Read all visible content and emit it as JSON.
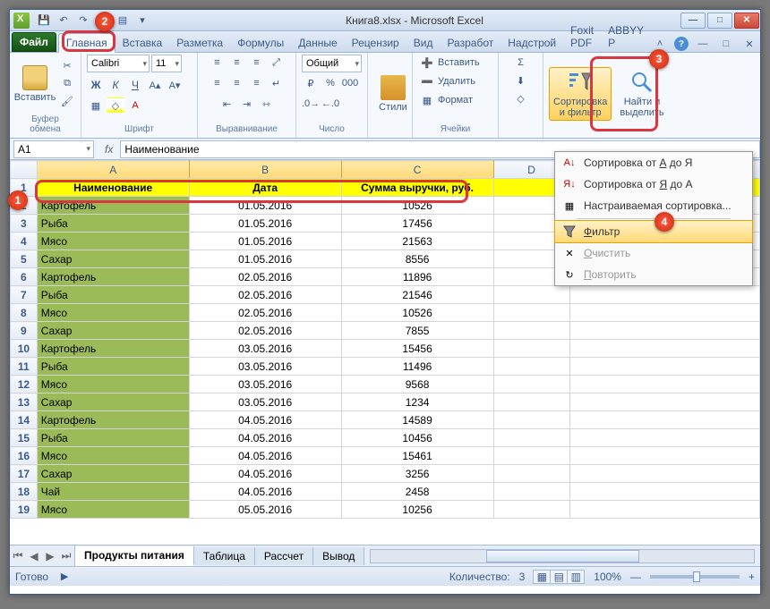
{
  "title": "Книга8.xlsx - Microsoft Excel",
  "qat": [
    "save",
    "undo",
    "redo",
    "print",
    "new"
  ],
  "tabs": {
    "file": "Файл",
    "items": [
      "Главная",
      "Вставка",
      "Разметка",
      "Формулы",
      "Данные",
      "Рецензир",
      "Вид",
      "Разработ",
      "Надстрой",
      "Foxit PDF",
      "ABBYY P"
    ],
    "active": 0
  },
  "ribbon": {
    "clipboard": {
      "label": "Буфер обмена",
      "paste": "Вставить"
    },
    "font": {
      "label": "Шрифт",
      "name": "Calibri",
      "size": "11"
    },
    "align": {
      "label": "Выравнивание"
    },
    "number": {
      "label": "Число",
      "format": "Общий"
    },
    "styles": {
      "label": "Стили"
    },
    "cells": {
      "label": "Ячейки",
      "insert": "Вставить",
      "delete": "Удалить",
      "format": "Формат"
    },
    "editing": {
      "sort": "Сортировка\nи фильтр",
      "find": "Найти и\nвыделить"
    }
  },
  "dropdown": {
    "sort_az": "Сортировка от А до Я",
    "sort_za": "Сортировка от Я до А",
    "custom": "Настраиваемая сортировка...",
    "filter": "Фильтр",
    "clear": "Очистить",
    "reapply": "Повторить",
    "az_u": "А",
    "za_u": "Я",
    "f_u": "Ф",
    "c_u": "О",
    "r_u": "П"
  },
  "namebox": "A1",
  "formula": "Наименование",
  "columns": [
    "A",
    "B",
    "C",
    "D"
  ],
  "header_row": [
    "Наименование",
    "Дата",
    "Сумма выручки, руб."
  ],
  "rows": [
    {
      "n": 2,
      "a": "Картофель",
      "b": "01.05.2016",
      "c": "10526"
    },
    {
      "n": 3,
      "a": "Рыба",
      "b": "01.05.2016",
      "c": "17456"
    },
    {
      "n": 4,
      "a": "Мясо",
      "b": "01.05.2016",
      "c": "21563"
    },
    {
      "n": 5,
      "a": "Сахар",
      "b": "01.05.2016",
      "c": "8556"
    },
    {
      "n": 6,
      "a": "Картофель",
      "b": "02.05.2016",
      "c": "11896"
    },
    {
      "n": 7,
      "a": "Рыба",
      "b": "02.05.2016",
      "c": "21546"
    },
    {
      "n": 8,
      "a": "Мясо",
      "b": "02.05.2016",
      "c": "10526"
    },
    {
      "n": 9,
      "a": "Сахар",
      "b": "02.05.2016",
      "c": "7855"
    },
    {
      "n": 10,
      "a": "Картофель",
      "b": "03.05.2016",
      "c": "15456"
    },
    {
      "n": 11,
      "a": "Рыба",
      "b": "03.05.2016",
      "c": "11496"
    },
    {
      "n": 12,
      "a": "Мясо",
      "b": "03.05.2016",
      "c": "9568"
    },
    {
      "n": 13,
      "a": "Сахар",
      "b": "03.05.2016",
      "c": "1234"
    },
    {
      "n": 14,
      "a": "Картофель",
      "b": "04.05.2016",
      "c": "14589"
    },
    {
      "n": 15,
      "a": "Рыба",
      "b": "04.05.2016",
      "c": "10456"
    },
    {
      "n": 16,
      "a": "Мясо",
      "b": "04.05.2016",
      "c": "15461"
    },
    {
      "n": 17,
      "a": "Сахар",
      "b": "04.05.2016",
      "c": "3256"
    },
    {
      "n": 18,
      "a": "Чай",
      "b": "04.05.2016",
      "c": "2458"
    },
    {
      "n": 19,
      "a": "Мясо",
      "b": "05.05.2016",
      "c": "10256"
    }
  ],
  "sheets": [
    "Продукты питания",
    "Таблица",
    "Рассчет",
    "Вывод"
  ],
  "status": {
    "ready": "Готово",
    "count_label": "Количество:",
    "count": "3",
    "zoom": "100%"
  }
}
